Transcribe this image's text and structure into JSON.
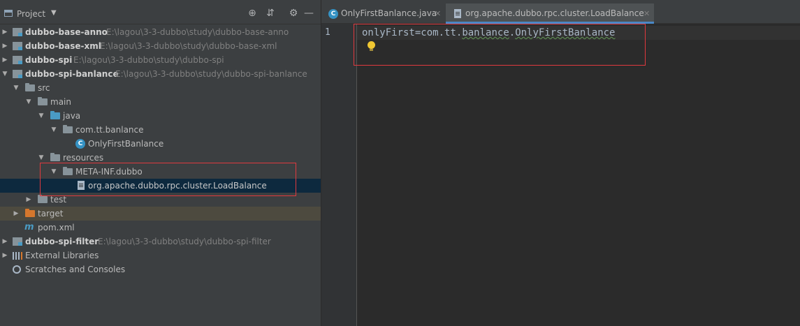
{
  "panel": {
    "title": "Project",
    "tools": [
      "locate-icon",
      "collapse-icon",
      "gear-icon",
      "hide-icon"
    ]
  },
  "tree": [
    {
      "name": "dubbo-base-anno",
      "path": "E:\\lagou\\3-3-dubbo\\study\\dubbo-base-anno"
    },
    {
      "name": "dubbo-base-xml",
      "path": "E:\\lagou\\3-3-dubbo\\study\\dubbo-base-xml"
    },
    {
      "name": "dubbo-spi",
      "path": "E:\\lagou\\3-3-dubbo\\study\\dubbo-spi"
    },
    {
      "name": "dubbo-spi-banlance",
      "path": "E:\\lagou\\3-3-dubbo\\study\\dubbo-spi-banlance"
    },
    {
      "name": "src"
    },
    {
      "name": "main"
    },
    {
      "name": "java"
    },
    {
      "name": "com.tt.banlance"
    },
    {
      "name": "OnlyFirstBanlance"
    },
    {
      "name": "resources"
    },
    {
      "name": "META-INF.dubbo"
    },
    {
      "name": "org.apache.dubbo.rpc.cluster.LoadBalance"
    },
    {
      "name": "test"
    },
    {
      "name": "target"
    },
    {
      "name": "pom.xml"
    },
    {
      "name": "dubbo-spi-filter",
      "path": "E:\\lagou\\3-3-dubbo\\study\\dubbo-spi-filter"
    },
    {
      "name": "External Libraries"
    },
    {
      "name": "Scratches and Consoles"
    }
  ],
  "tabs": [
    {
      "label": "OnlyFirstBanlance.java",
      "icon": "class-icon",
      "active": false
    },
    {
      "label": "org.apache.dubbo.rpc.cluster.LoadBalance",
      "icon": "file-icon",
      "active": true
    }
  ],
  "editor": {
    "line_number": "1",
    "code_key": "onlyFirst",
    "code_eq": "=",
    "code_pkg1": "com.tt.",
    "code_pkg2": "banlance",
    "code_dot": ".",
    "code_cls": "OnlyFirstBanlance"
  },
  "colors": {
    "highlight_box": "#e0393e",
    "selection": "#0d293e",
    "class_icon": "#3592c4",
    "folder_blue": "#4a9bc4",
    "folder_orange": "#d5772d"
  }
}
